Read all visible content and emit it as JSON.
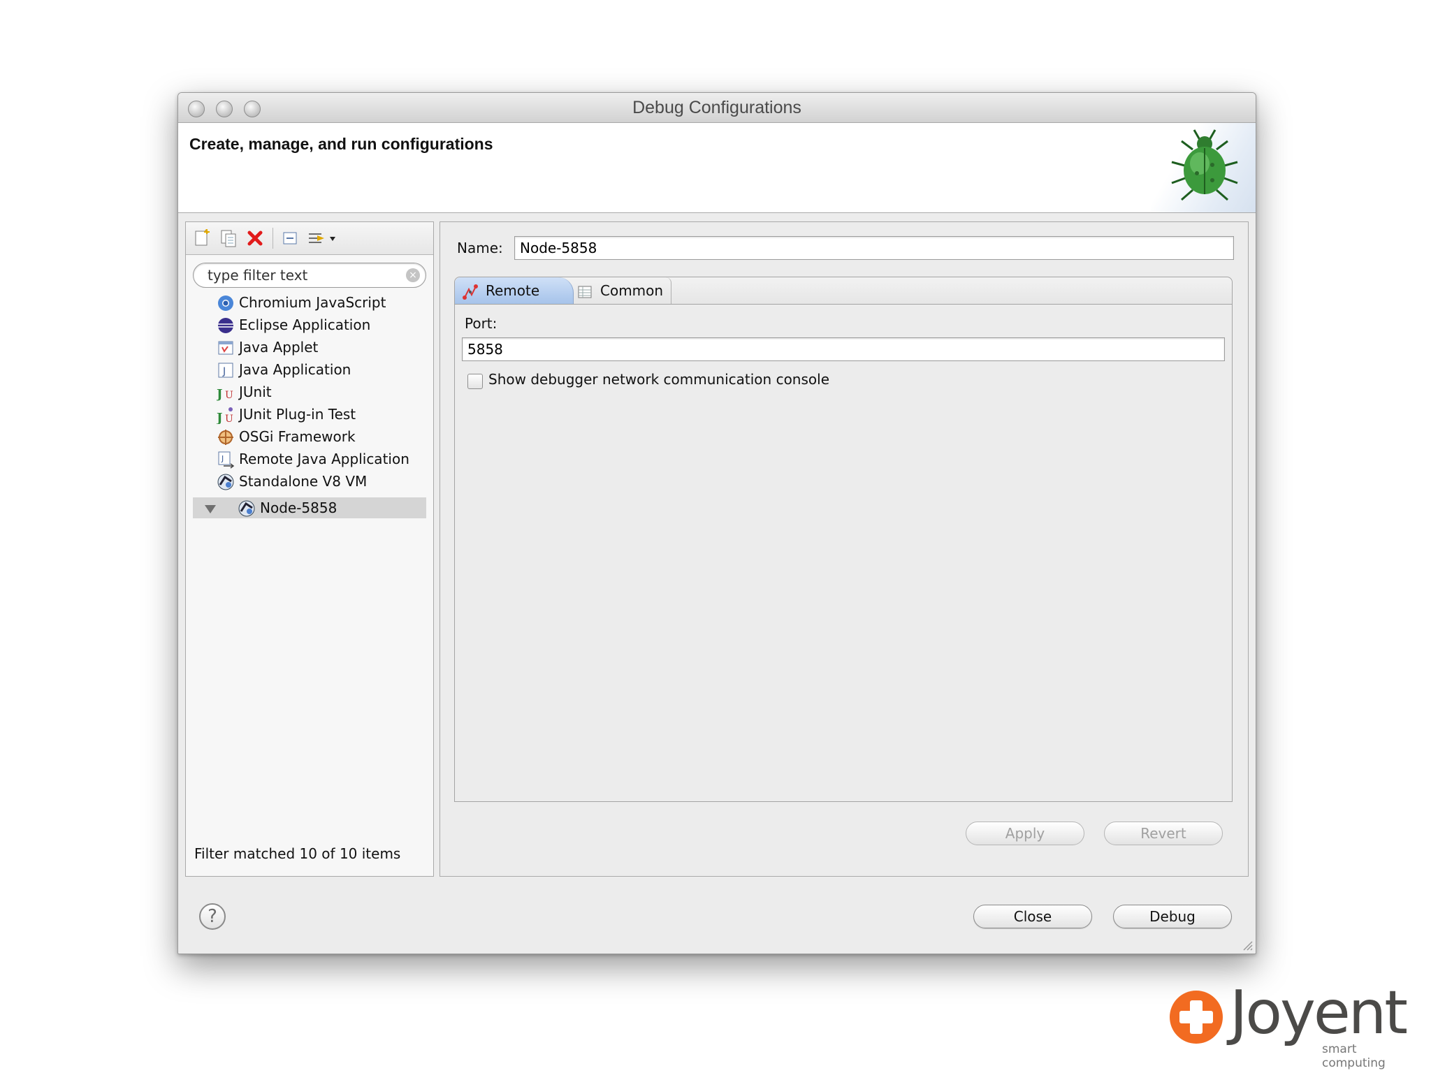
{
  "window": {
    "title": "Debug Configurations"
  },
  "header": {
    "title": "Create, manage, and run configurations"
  },
  "left_panel": {
    "filter_placeholder": "type filter text",
    "items": [
      {
        "label": "Chromium JavaScript",
        "icon": "chromium-icon"
      },
      {
        "label": "Eclipse Application",
        "icon": "eclipse-icon"
      },
      {
        "label": "Java Applet",
        "icon": "java-applet-icon"
      },
      {
        "label": "Java Application",
        "icon": "java-application-icon"
      },
      {
        "label": "JUnit",
        "icon": "junit-icon"
      },
      {
        "label": "JUnit Plug-in Test",
        "icon": "junit-plugin-icon"
      },
      {
        "label": "OSGi Framework",
        "icon": "osgi-icon"
      },
      {
        "label": "Remote Java Application",
        "icon": "remote-java-icon"
      },
      {
        "label": "Standalone V8 VM",
        "icon": "v8-icon",
        "expanded": true
      },
      {
        "label": "Node-5858",
        "icon": "v8-icon",
        "selected": true
      }
    ],
    "status": "Filter matched 10 of 10 items"
  },
  "right_panel": {
    "name_label": "Name:",
    "name_value": "Node-5858",
    "tabs": [
      {
        "label": "Remote",
        "icon": "remote-icon",
        "active": true
      },
      {
        "label": "Common",
        "icon": "common-icon",
        "active": false
      }
    ],
    "port_label": "Port:",
    "port_value": "5858",
    "console_checkbox_label": "Show debugger network communication console",
    "console_checkbox_checked": false,
    "apply_label": "Apply",
    "revert_label": "Revert"
  },
  "footer": {
    "help_label": "?",
    "close_label": "Close",
    "debug_label": "Debug"
  },
  "logo": {
    "wordmark": "Joyent",
    "tagline": "smart computing"
  },
  "colors": {
    "accent_tab": "#a6c3ea",
    "selection": "#d5d5d5",
    "logo_orange": "#f26b21"
  }
}
